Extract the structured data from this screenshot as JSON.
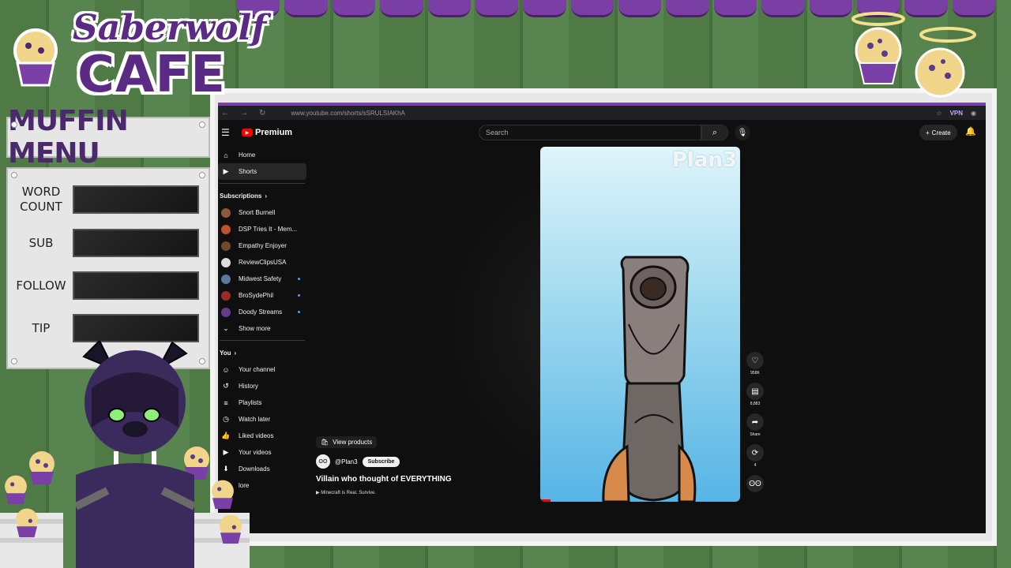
{
  "overlay": {
    "logo_line1": "Saberwolf",
    "logo_line2": "CAFE",
    "menu_title": "MUFFIN MENU",
    "menu_rows": [
      {
        "label": "WORD\nCOUNT",
        "label_top": "WORD",
        "label_bottom": "COUNT"
      },
      {
        "label": "SUB"
      },
      {
        "label": "FOLLOW"
      },
      {
        "label": "TIP"
      }
    ]
  },
  "browser": {
    "url": "www.youtube.com/shorts/sSRULSIAKhA",
    "vpn": "VPN"
  },
  "youtube": {
    "brand": "Premium",
    "search_placeholder": "Search",
    "create_label": "Create",
    "sidebar": {
      "main": [
        {
          "label": "Home",
          "icon": "home-icon"
        },
        {
          "label": "Shorts",
          "icon": "shorts-icon",
          "active": true
        }
      ],
      "subscriptions_title": "Subscriptions",
      "subscriptions": [
        {
          "label": "Snort Burnell",
          "avatar_color": "#8a5a3a",
          "new": false
        },
        {
          "label": "DSP Tries It - Mem...",
          "avatar_color": "#c05030",
          "new": false
        },
        {
          "label": "Empathy Enjoyer",
          "avatar_color": "#6b4a2f",
          "new": false
        },
        {
          "label": "ReviewClipsUSA",
          "avatar_color": "#dddddd",
          "new": false
        },
        {
          "label": "Midwest Safety",
          "avatar_color": "#5a7a9a",
          "new": true
        },
        {
          "label": "BroSydePhil",
          "avatar_color": "#9a2a2a",
          "new": true
        },
        {
          "label": "Doody Streams",
          "avatar_color": "#6a3a8a",
          "new": true
        }
      ],
      "show_more": "Show more",
      "you_title": "You",
      "you_items": [
        {
          "label": "Your channel",
          "icon": "channel-icon"
        },
        {
          "label": "History",
          "icon": "history-icon"
        },
        {
          "label": "Playlists",
          "icon": "playlists-icon"
        },
        {
          "label": "Watch later",
          "icon": "watch-later-icon"
        },
        {
          "label": "Liked videos",
          "icon": "like-icon"
        },
        {
          "label": "Your videos",
          "icon": "your-videos-icon"
        },
        {
          "label": "Downloads",
          "icon": "download-icon"
        }
      ],
      "more_label": "lore"
    },
    "short": {
      "watermark": "Plan3",
      "view_products": "View products",
      "channel": "@Plan3",
      "subscribe": "Subscribe",
      "title": "Villain who thought of EVERYTHING",
      "music": "▶ Minecraft is Real. Survive.",
      "progress": 0.05,
      "actions": [
        {
          "icon": "like-icon",
          "label": "958K"
        },
        {
          "icon": "comment-icon",
          "label": "8,883"
        },
        {
          "icon": "share-icon",
          "label": "Share"
        },
        {
          "icon": "remix-icon",
          "label": "4"
        },
        {
          "icon": "sound-icon",
          "label": ""
        }
      ]
    }
  },
  "colors": {
    "brand_purple": "#5b2a85",
    "yt_red": "#ff0000",
    "wood_green": "#4f7a46"
  }
}
